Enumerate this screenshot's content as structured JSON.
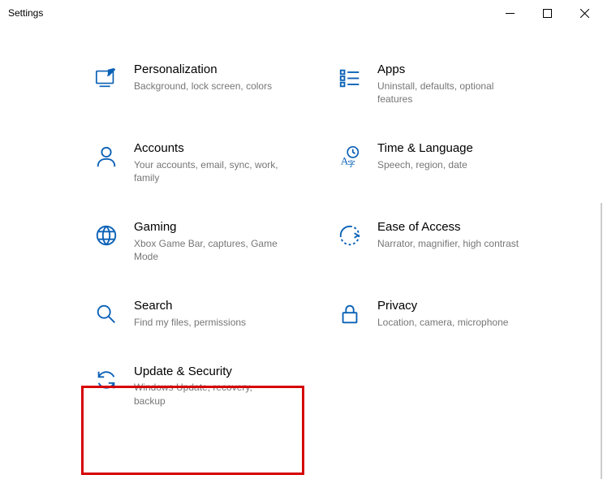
{
  "window": {
    "title": "Settings"
  },
  "items": [
    {
      "title": "Personalization",
      "desc": "Background, lock screen, colors"
    },
    {
      "title": "Apps",
      "desc": "Uninstall, defaults, optional features"
    },
    {
      "title": "Accounts",
      "desc": "Your accounts, email, sync, work, family"
    },
    {
      "title": "Time & Language",
      "desc": "Speech, region, date"
    },
    {
      "title": "Gaming",
      "desc": "Xbox Game Bar, captures, Game Mode"
    },
    {
      "title": "Ease of Access",
      "desc": "Narrator, magnifier, high contrast"
    },
    {
      "title": "Search",
      "desc": "Find my files, permissions"
    },
    {
      "title": "Privacy",
      "desc": "Location, camera, microphone"
    },
    {
      "title": "Update & Security",
      "desc": "Windows Update, recovery, backup"
    }
  ],
  "colors": {
    "accent": "#0a61b6",
    "desc": "#767676",
    "highlight": "#d60000"
  }
}
